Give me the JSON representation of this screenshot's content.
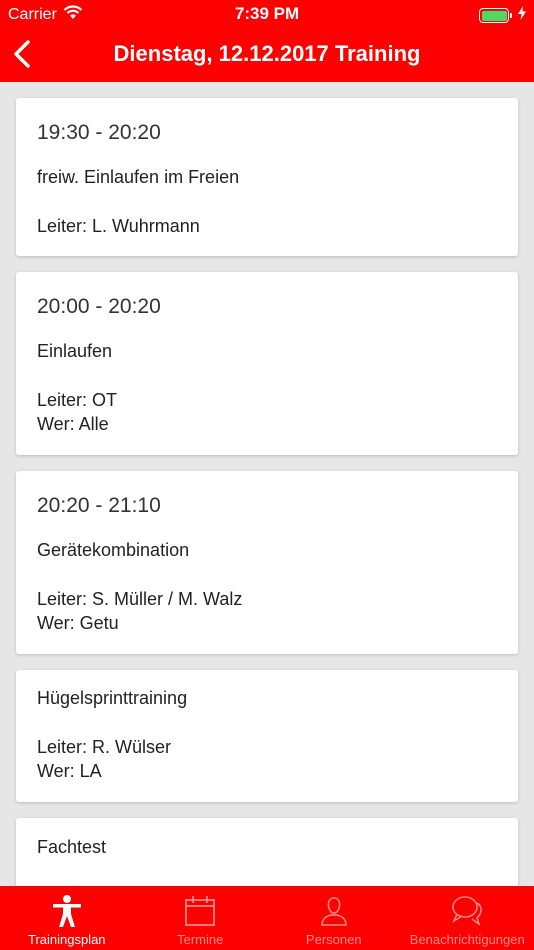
{
  "status_bar": {
    "carrier": "Carrier",
    "time": "7:39 PM"
  },
  "nav": {
    "title": "Dienstag, 12.12.2017 Training"
  },
  "sessions": [
    {
      "time": "19:30 - 20:20",
      "activity": "freiw. Einlaufen im Freien",
      "leiter": "Leiter: L. Wuhrmann",
      "wer": ""
    },
    {
      "time": "20:00 - 20:20",
      "activity": "Einlaufen",
      "leiter": "Leiter: OT",
      "wer": "Wer: Alle"
    },
    {
      "time": "20:20 - 21:10",
      "activity": "Gerätekombination",
      "leiter": "Leiter: S. Müller / M. Walz",
      "wer": "Wer: Getu"
    },
    {
      "time": "",
      "activity": "Hügelsprinttraining",
      "leiter": "Leiter: R. Wülser",
      "wer": "Wer: LA"
    },
    {
      "time": "",
      "activity": "Fachtest",
      "leiter": "",
      "wer": ""
    }
  ],
  "tabs": [
    {
      "label": "Trainingsplan",
      "icon": "person-icon",
      "active": true
    },
    {
      "label": "Termine",
      "icon": "calendar-icon",
      "active": false
    },
    {
      "label": "Personen",
      "icon": "user-icon",
      "active": false
    },
    {
      "label": "Benachrichtigungen",
      "icon": "chat-bubbles-icon",
      "active": false
    }
  ],
  "colors": {
    "accent": "#ff0000",
    "tab_inactive": "#ff8a8a",
    "battery": "#4cd964"
  }
}
